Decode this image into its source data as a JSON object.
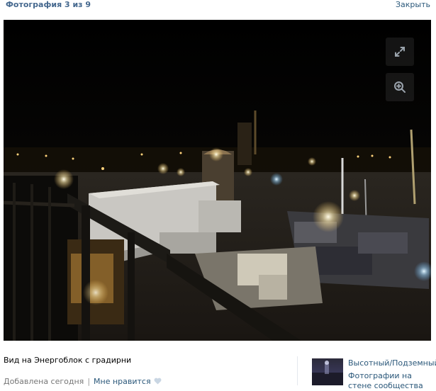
{
  "header": {
    "title": "Фотография 3 из 9",
    "close_label": "Закрыть"
  },
  "photo": {
    "alt": "Вид на Энергоблок с градирни",
    "controls": [
      {
        "name": "expand",
        "icon": "expand-icon"
      },
      {
        "name": "zoom",
        "icon": "zoom-in-icon"
      }
    ]
  },
  "caption": {
    "description": "Вид на Энергоблок с градирни",
    "added": "Добавлена сегодня",
    "separator": "|",
    "like": "Мне нравится",
    "like_icon": "heart-icon"
  },
  "source": {
    "name": "Высотный/Подземный",
    "subtitle": "Фотографии на стене сообщества"
  },
  "colors": {
    "title": "#45688e",
    "link": "#2b587a",
    "muted": "#777777",
    "photo_bg": "#050505"
  }
}
